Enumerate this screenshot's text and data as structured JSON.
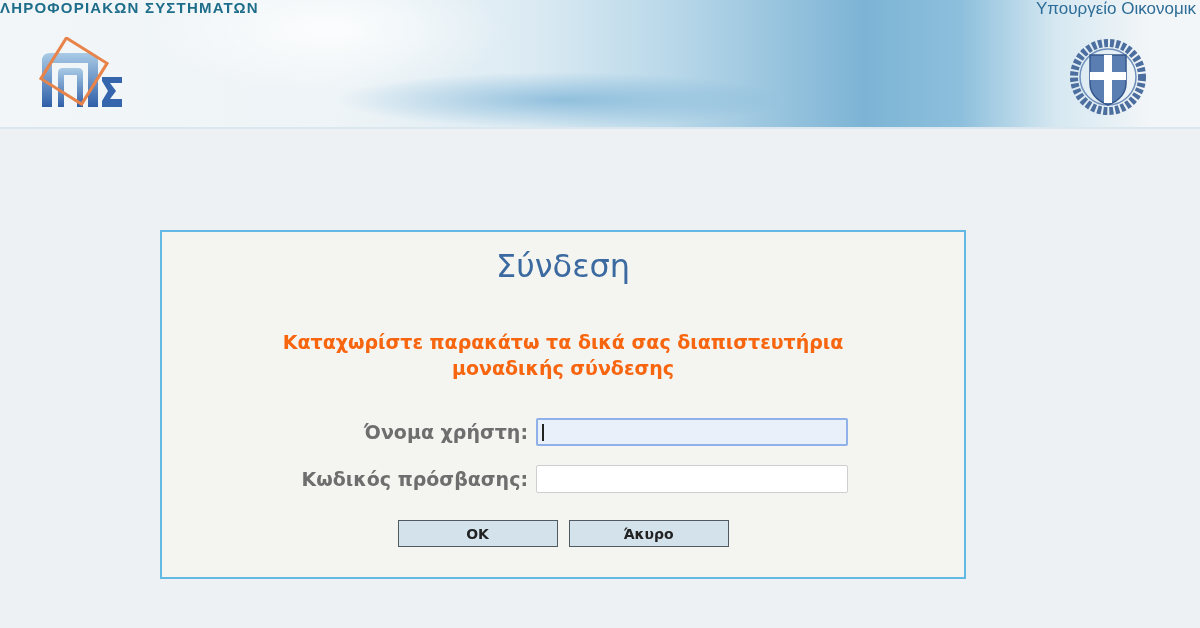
{
  "header": {
    "org_name": "ΛΗΡΟΦΟΡΙΑΚΩΝ ΣΥΣΤΗΜΑΤΩΝ",
    "ministry": "Υπουργείο Οικονομικ"
  },
  "login": {
    "title": "Σύνδεση",
    "message": "Καταχωρίστε παρακάτω τα δικά σας διαπιστευτήρια μοναδικής σύνδεσης",
    "fields": [
      {
        "label": "Όνομα χρήστη:",
        "focused": true
      },
      {
        "label": "Κωδικός πρόσβασης:",
        "focused": false
      }
    ],
    "buttons": [
      {
        "label": "OK"
      },
      {
        "label": "Άκυρο"
      }
    ]
  }
}
